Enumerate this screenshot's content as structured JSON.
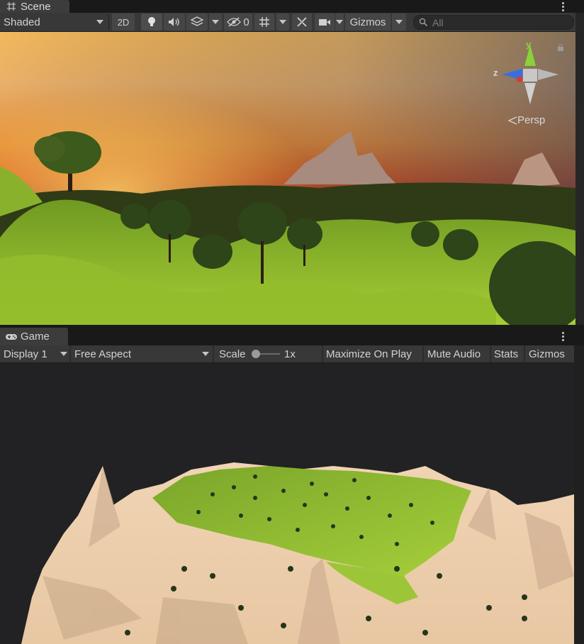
{
  "scene": {
    "tab_label": "Scene",
    "shading_mode": "Shaded",
    "toggle_2d": "2D",
    "hidden_count": "0",
    "gizmos_label": "Gizmos",
    "search_placeholder": "All",
    "projection_label": "Persp",
    "axes": {
      "y": "y",
      "z": "z"
    }
  },
  "game": {
    "tab_label": "Game",
    "display": "Display 1",
    "aspect": "Free Aspect",
    "scale_label": "Scale",
    "scale_value": "1x",
    "scale_slider": 0.05,
    "maximize_on_play": "Maximize On Play",
    "mute_audio": "Mute Audio",
    "stats": "Stats",
    "gizmos": "Gizmos"
  },
  "colors": {
    "panel_bg": "#383838",
    "tab_bg": "#3c3c3c",
    "strip_bg": "#191919",
    "game_bg": "#222224",
    "axis_y": "#8ad13a",
    "axis_x": "#e0372a",
    "axis_z": "#3a6ee0"
  },
  "icons": {
    "scene_tab": "hash-icon",
    "game_tab": "gamepad-icon",
    "lighting": "lightbulb-icon",
    "audio": "speaker-icon",
    "effects": "layers-icon",
    "visibility": "eye-slash-icon",
    "grid": "grid-icon",
    "tools": "wrench-icon",
    "camera": "camera-icon",
    "search": "search-icon",
    "lock": "lock-icon",
    "menu": "kebab-icon"
  }
}
